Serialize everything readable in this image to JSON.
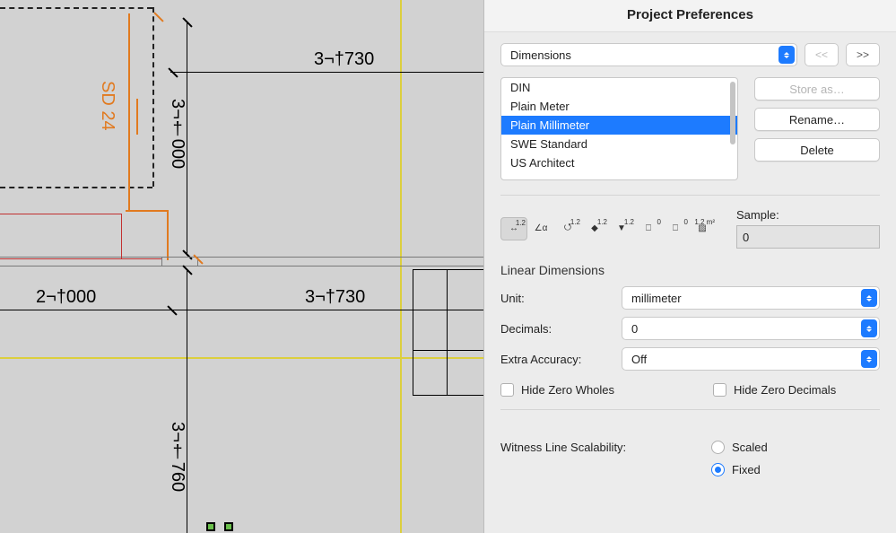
{
  "panel": {
    "title": "Project Preferences",
    "category": "Dimensions",
    "nav_prev": "<<",
    "nav_next": ">>",
    "schemes": [
      "DIN",
      "Plain Meter",
      "Plain Millimeter",
      "SWE Standard",
      "US Architect"
    ],
    "selected_scheme_index": 2,
    "btn_store": "Store as…",
    "btn_rename": "Rename…",
    "btn_delete": "Delete",
    "sample_label": "Sample:",
    "sample_value": "0",
    "section_linear": "Linear Dimensions",
    "unit_label": "Unit:",
    "unit_value": "millimeter",
    "decimals_label": "Decimals:",
    "decimals_value": "0",
    "extra_label": "Extra Accuracy:",
    "extra_value": "Off",
    "hide_wholes": "Hide Zero Wholes",
    "hide_decimals": "Hide Zero Decimals",
    "witness_label": "Witness Line Scalability:",
    "radio_scaled": "Scaled",
    "radio_fixed": "Fixed"
  },
  "cad": {
    "dim_sd24": "SD 24",
    "dim_3p000": "3¬†000",
    "dim_3p730_top": "3¬†730",
    "dim_2p000": "2¬†000",
    "dim_3p730_mid": "3¬†730",
    "dim_3p760": "3¬†760"
  }
}
